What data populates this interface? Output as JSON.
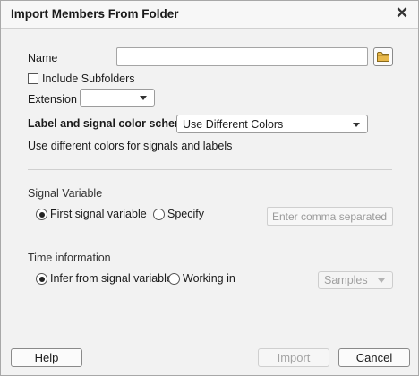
{
  "dialog": {
    "title": "Import Members From Folder",
    "close_glyph": "✕"
  },
  "name": {
    "label": "Name",
    "value": "",
    "browse_icon": "folder-icon"
  },
  "include_subfolders": {
    "label": "Include Subfolders",
    "checked": false
  },
  "extension": {
    "label": "Extension",
    "value": ""
  },
  "color_scheme": {
    "label": "Label and signal color scheme:",
    "value": "Use Different Colors",
    "description": "Use different colors for signals and labels"
  },
  "signal_variable": {
    "heading": "Signal Variable",
    "option_first": "First signal variable",
    "option_specify": "Specify",
    "selected": "first",
    "specify_placeholder": "Enter comma separated na"
  },
  "time_information": {
    "heading": "Time information",
    "option_infer": "Infer from signal variable",
    "option_working": "Working in",
    "selected": "infer",
    "units_value": "Samples"
  },
  "buttons": {
    "help": "Help",
    "import": "Import",
    "cancel": "Cancel"
  },
  "colors": {
    "folder_icon": "#e8b84a"
  }
}
